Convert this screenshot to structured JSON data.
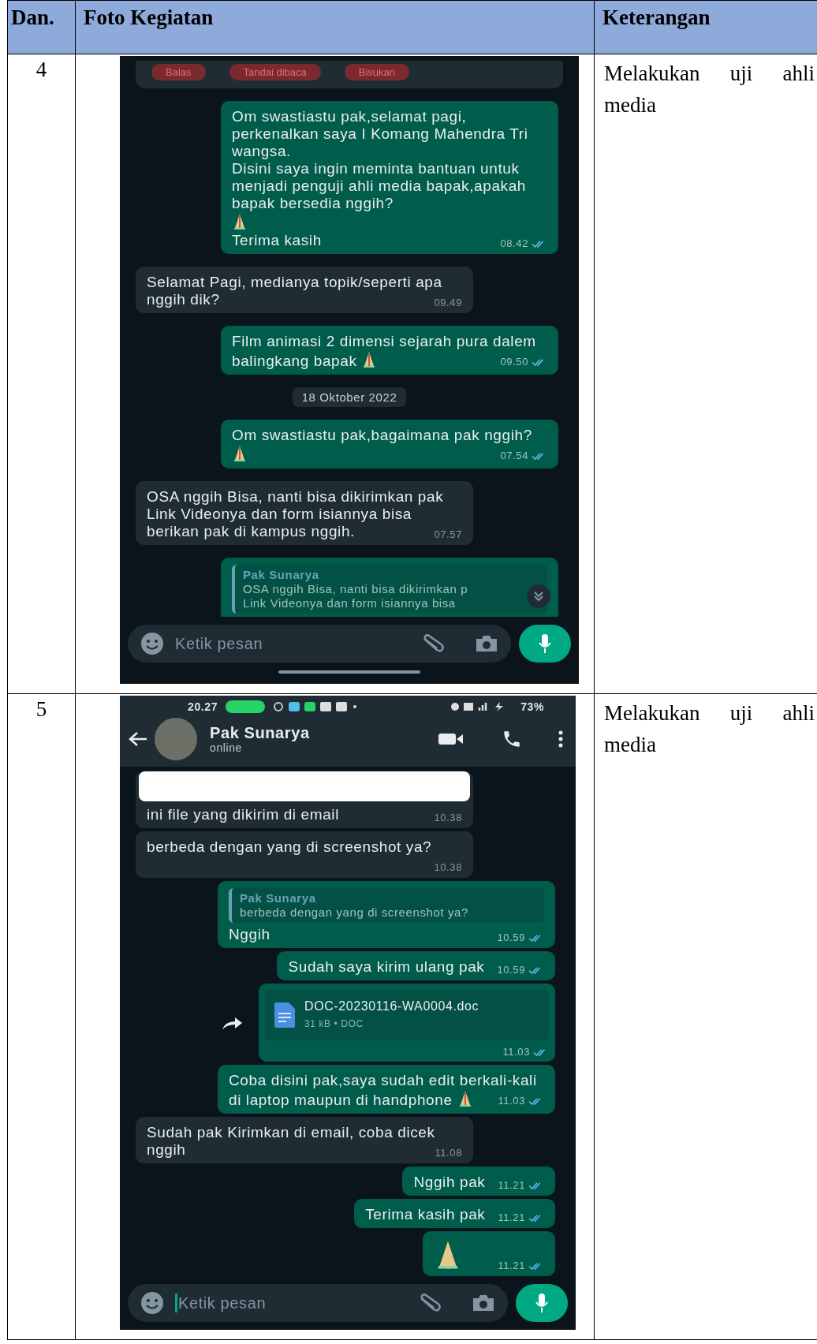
{
  "table": {
    "columns": [
      "Dan.",
      "Foto Kegiatan",
      "Keterangan"
    ],
    "rows": [
      {
        "number": "4",
        "description": "Melakukan uji ahli media",
        "chat": {
          "quick_actions": [
            "Balas",
            "Tandai dibaca",
            "Bisukan"
          ],
          "messages": [
            {
              "kind": "sent",
              "text": "Om swastiastu pak,selamat pagi, perkenalkan saya I Komang Mahendra Tri wangsa.\nDisini saya ingin meminta bantuan untuk menjadi penguji ahli media bapak,apakah bapak bersedia nggih?\n",
              "prayer": true,
              "text_after": "\nTerima kasih",
              "time": "08.42",
              "read": true
            },
            {
              "kind": "received",
              "text": "Selamat Pagi, medianya topik/seperti apa nggih dik?",
              "time": "09.49"
            },
            {
              "kind": "sent",
              "text": "Film animasi 2 dimensi sejarah pura dalem balingkang bapak ",
              "prayer": true,
              "time": "09.50",
              "read": true
            },
            {
              "kind": "date",
              "text": "18 Oktober 2022"
            },
            {
              "kind": "sent",
              "text": "Om swastiastu pak,bagaimana pak nggih? ",
              "prayer": true,
              "time": "07.54",
              "read": true
            },
            {
              "kind": "received",
              "text": "OSA nggih Bisa, nanti bisa dikirimkan pak Link Videonya dan form isiannya bisa berikan pak di kampus nggih.",
              "time": "07.57"
            },
            {
              "kind": "sent_reply",
              "quote_author": "Pak Sunarya",
              "quote_lines": [
                "OSA nggih Bisa, nanti bisa dikirimkan p",
                "Link Videonya dan form isiannya bisa"
              ],
              "scroll_button": true
            }
          ],
          "composer": {
            "placeholder": "Ketik pesan",
            "focused": false
          }
        }
      },
      {
        "number": "5",
        "description": "Melakukan uji ahli media",
        "chat": {
          "status_bar": {
            "time": "20.27",
            "battery": "73%"
          },
          "contact": {
            "name": "Pak Sunarya",
            "status": "online"
          },
          "messages": [
            {
              "kind": "received_image",
              "text": "ini file yang dikirim di email",
              "time": "10.38"
            },
            {
              "kind": "received",
              "text": "berbeda dengan yang di screenshot ya?",
              "time": "10.38"
            },
            {
              "kind": "sent_reply",
              "quote_author": "Pak Sunarya",
              "quote_lines": [
                "berbeda dengan yang di screenshot ya?"
              ],
              "text": "Nggih",
              "time": "10.59",
              "read": true
            },
            {
              "kind": "sent",
              "text": "Sudah saya kirim ulang pak",
              "time": "10.59",
              "read": true
            },
            {
              "kind": "sent_file",
              "file_name": "DOC-20230116-WA0004.doc",
              "file_meta": "31 kB • DOC",
              "time": "11.03",
              "read": true
            },
            {
              "kind": "sent",
              "text": "Coba disini pak,saya sudah edit berkali-kali di laptop maupun di handphone ",
              "prayer": true,
              "time": "11.03",
              "read": true
            },
            {
              "kind": "received",
              "text": "Sudah pak Kirimkan di email, coba dicek nggih",
              "time": "11.08"
            },
            {
              "kind": "sent",
              "text": "Nggih pak",
              "time": "11.21",
              "read": true
            },
            {
              "kind": "sent",
              "text": "Terima kasih pak",
              "time": "11.21",
              "read": true
            },
            {
              "kind": "sent_emoji",
              "time": "11.21",
              "read": true
            }
          ],
          "composer": {
            "placeholder": "Ketik pesan",
            "focused": true
          }
        }
      }
    ]
  }
}
